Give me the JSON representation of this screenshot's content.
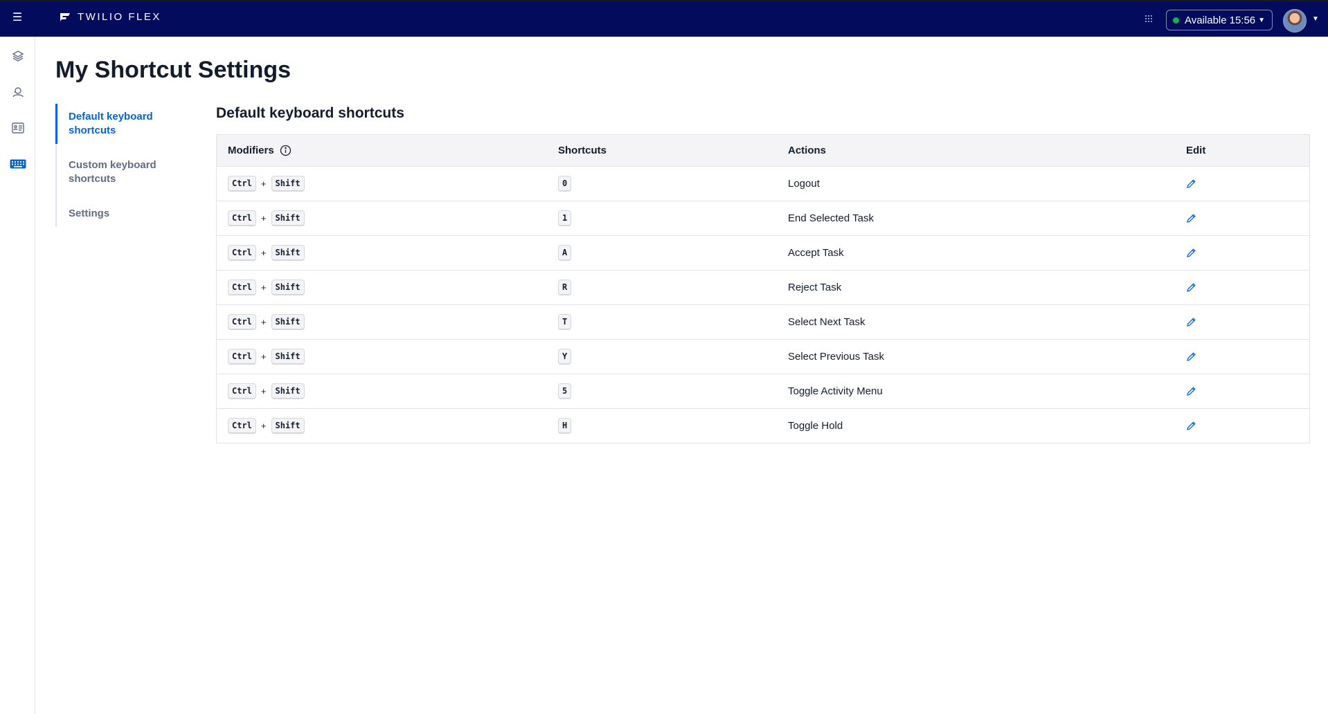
{
  "header": {
    "brand": "TWILIO FLEX",
    "status": "Available",
    "time": "15:56"
  },
  "leftnav": {
    "items": [
      "layers-icon",
      "agents-icon",
      "contact-card-icon",
      "keyboard-icon"
    ],
    "active": "keyboard-icon"
  },
  "page": {
    "title": "My Shortcut Settings"
  },
  "subnav": {
    "items": [
      {
        "label": "Default keyboard shortcuts",
        "line1": "Default keyboard",
        "line2": "shortcuts"
      },
      {
        "label": "Custom keyboard shortcuts",
        "line1": "Custom keyboard",
        "line2": "shortcuts"
      },
      {
        "label": "Settings",
        "line1": "Settings",
        "line2": ""
      }
    ],
    "active_index": 0
  },
  "section": {
    "title": "Default keyboard shortcuts"
  },
  "table": {
    "headers": {
      "modifiers": "Modifiers",
      "shortcuts": "Shortcuts",
      "actions": "Actions",
      "edit": "Edit"
    },
    "plus": "+",
    "rows": [
      {
        "mod1": "Ctrl",
        "mod2": "Shift",
        "key": "0",
        "action": "Logout"
      },
      {
        "mod1": "Ctrl",
        "mod2": "Shift",
        "key": "1",
        "action": "End Selected Task"
      },
      {
        "mod1": "Ctrl",
        "mod2": "Shift",
        "key": "A",
        "action": "Accept Task"
      },
      {
        "mod1": "Ctrl",
        "mod2": "Shift",
        "key": "R",
        "action": "Reject Task"
      },
      {
        "mod1": "Ctrl",
        "mod2": "Shift",
        "key": "T",
        "action": "Select Next Task"
      },
      {
        "mod1": "Ctrl",
        "mod2": "Shift",
        "key": "Y",
        "action": "Select Previous Task"
      },
      {
        "mod1": "Ctrl",
        "mod2": "Shift",
        "key": "5",
        "action": "Toggle Activity Menu"
      },
      {
        "mod1": "Ctrl",
        "mod2": "Shift",
        "key": "H",
        "action": "Toggle Hold"
      }
    ]
  },
  "colors": {
    "topbar": "#030b5d",
    "accent": "#0263e0",
    "status_dot": "#14b053"
  }
}
